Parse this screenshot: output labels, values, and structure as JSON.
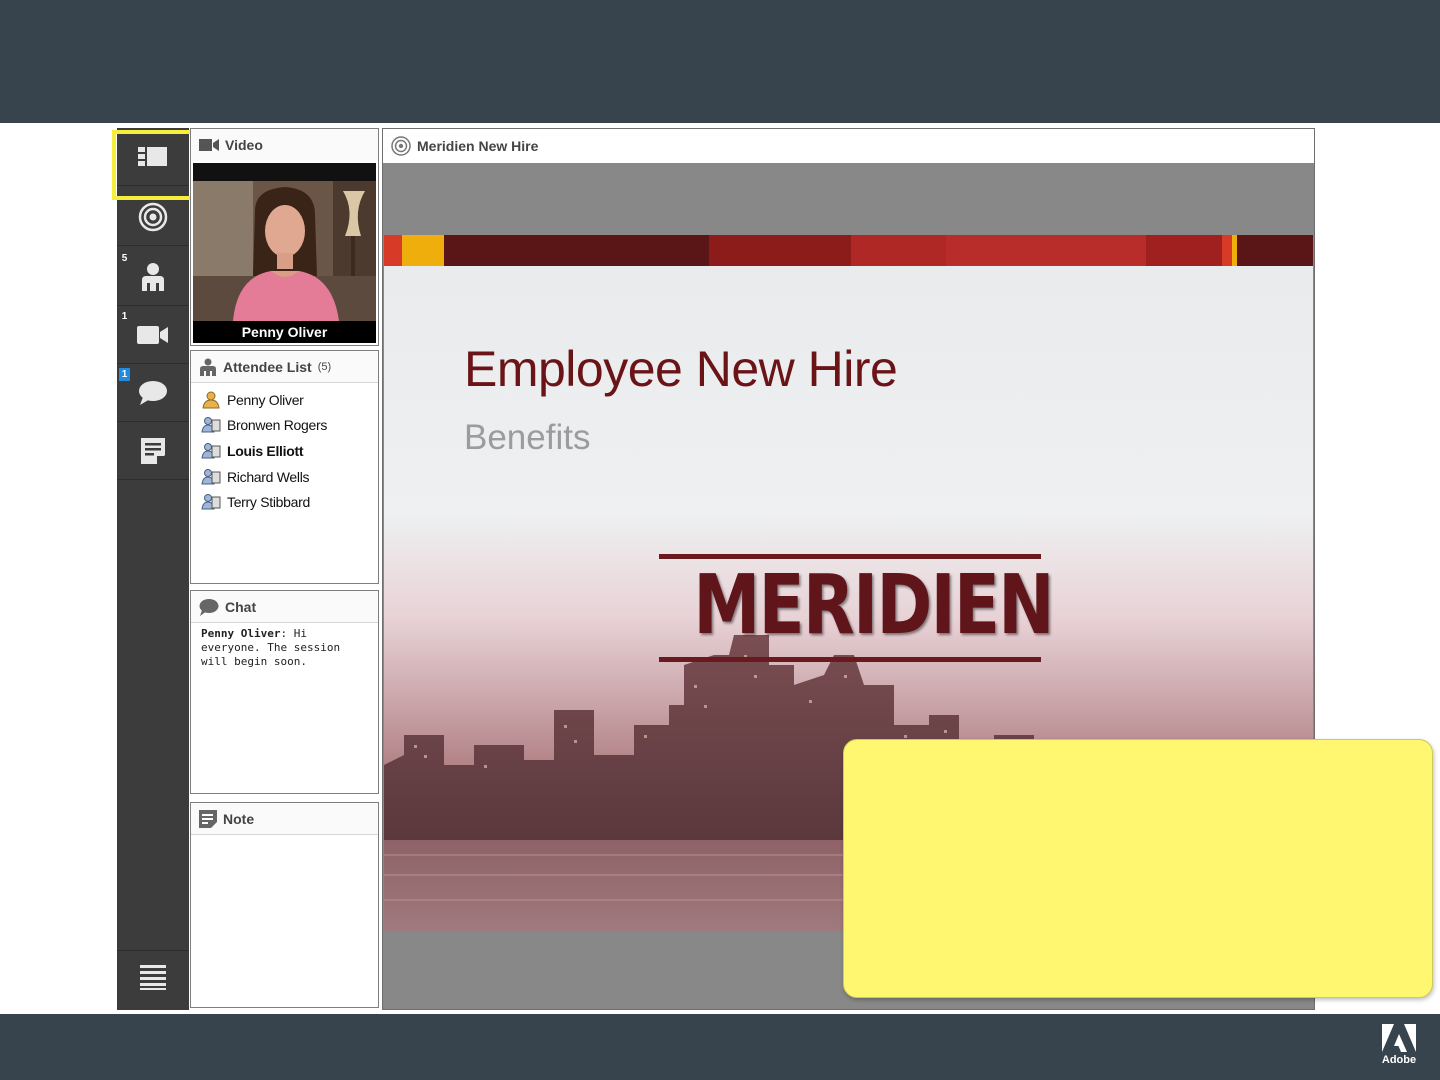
{
  "rail": {
    "badges": {
      "attendees": "5",
      "video": "1",
      "chat": "1"
    }
  },
  "video_pod": {
    "title": "Video",
    "participant_name": "Penny Oliver"
  },
  "attendee_pod": {
    "title": "Attendee List",
    "count": "(5)",
    "attendees": [
      {
        "name": "Penny Oliver",
        "role": "host",
        "bold": false
      },
      {
        "name": "Bronwen Rogers",
        "role": "participant",
        "bold": false
      },
      {
        "name": "Louis Elliott",
        "role": "participant",
        "bold": true
      },
      {
        "name": "Richard Wells",
        "role": "participant",
        "bold": false
      },
      {
        "name": "Terry Stibbard",
        "role": "participant",
        "bold": false
      }
    ]
  },
  "chat_pod": {
    "title": "Chat",
    "messages": [
      {
        "sender": "Penny Oliver",
        "text": ": Hi everyone. The session will begin soon."
      }
    ]
  },
  "note_pod": {
    "title": "Note"
  },
  "share_pod": {
    "title": "Meridien New Hire",
    "slide": {
      "title": "Employee New Hire",
      "subtitle": "Benefits",
      "logo_text": "MERIDIEN"
    }
  },
  "branding": {
    "logo_word": "Adobe"
  },
  "colors": {
    "band": "#37444e",
    "rail": "#3c3c3c",
    "highlight": "#f6ee3c",
    "callout": "#fef76f",
    "slide_title": "#6b1418"
  }
}
